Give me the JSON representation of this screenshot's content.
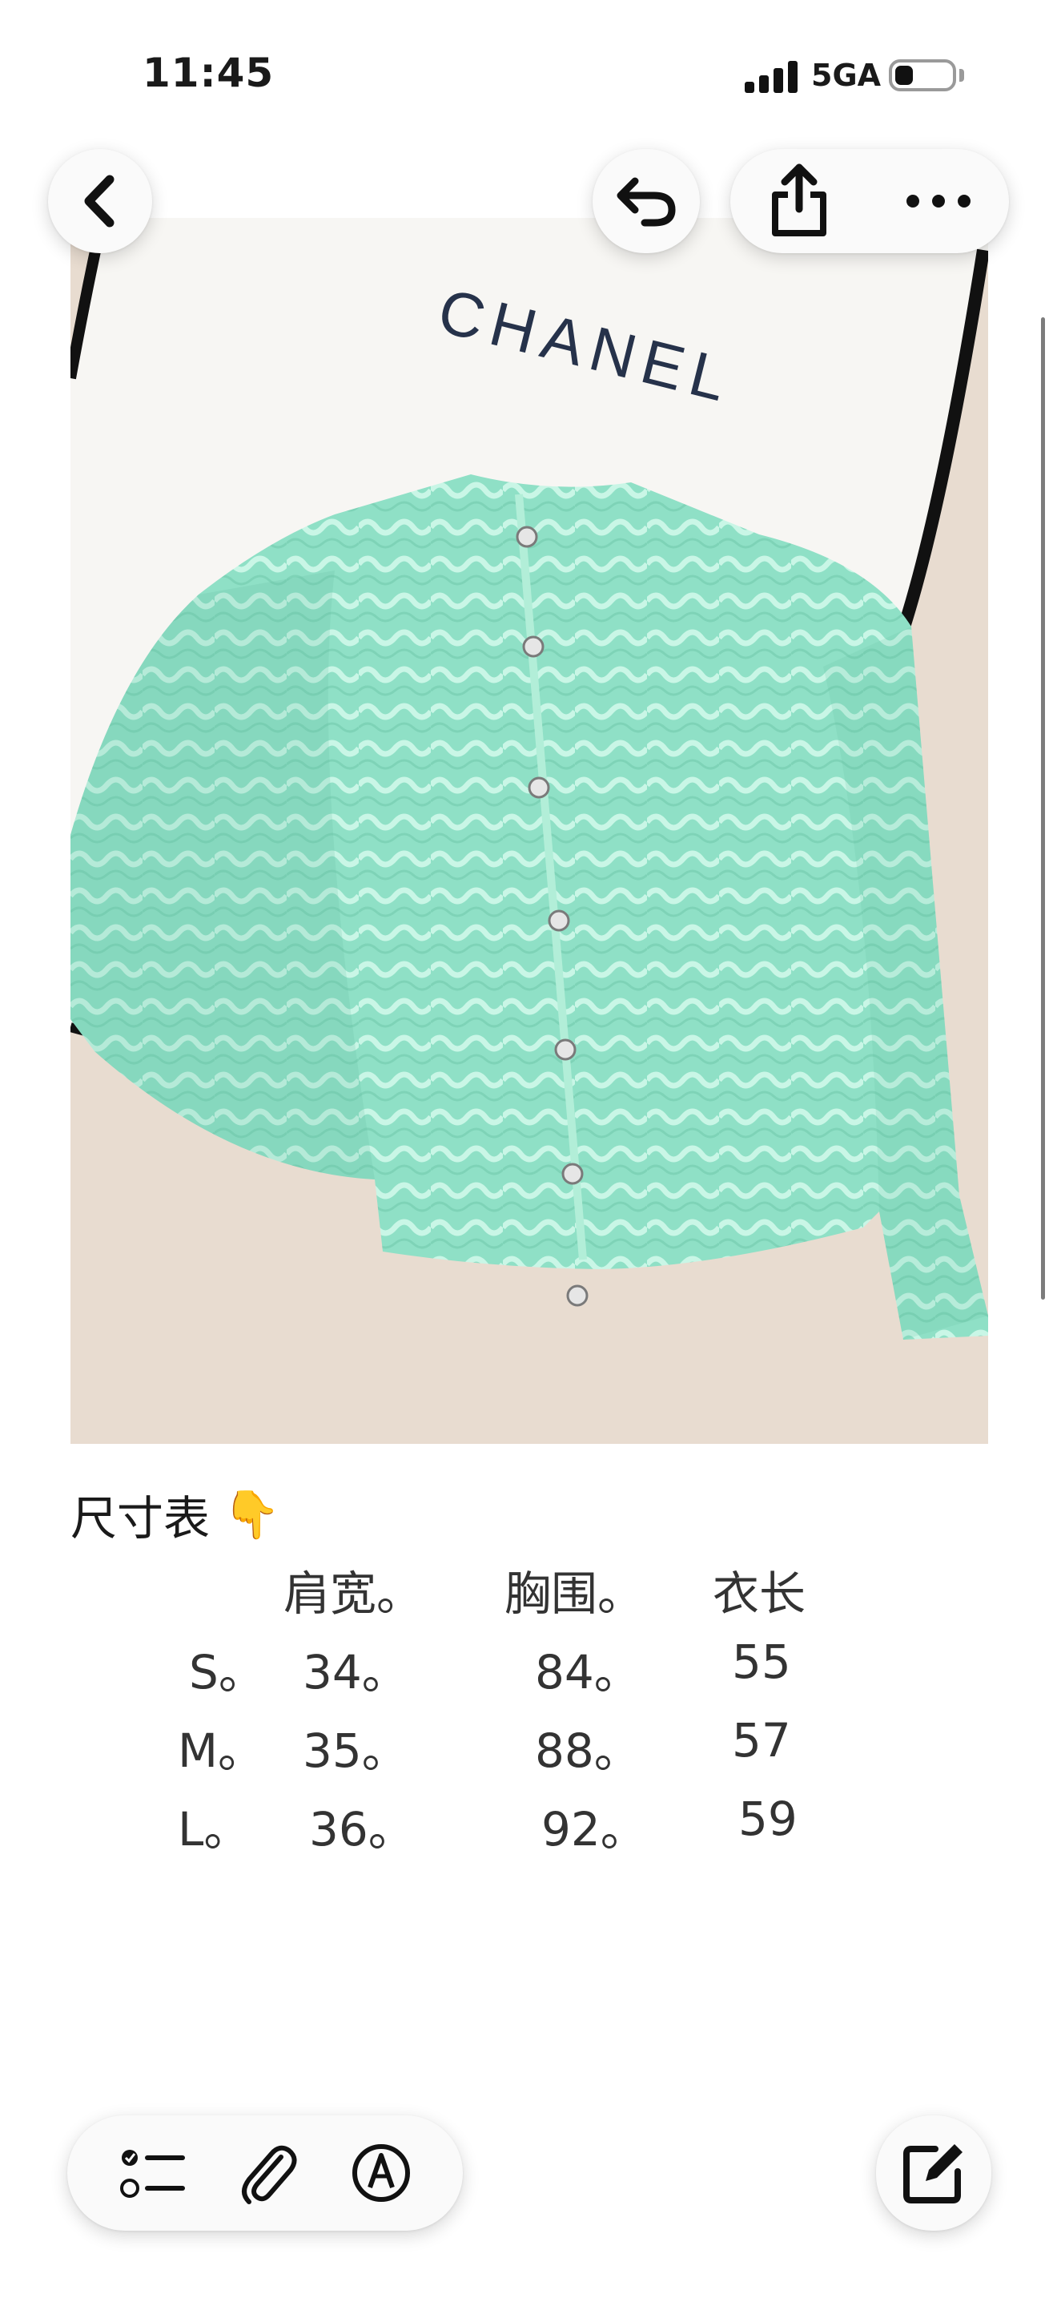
{
  "status_bar": {
    "time": "11:45",
    "network": "5GA",
    "battery_level": 0.25,
    "signal_bars": 4
  },
  "toolbar_top": {
    "back_icon": "chevron-left-icon",
    "undo_icon": "undo-icon",
    "share_icon": "share-icon",
    "more_icon": "more-icon"
  },
  "photo": {
    "brand_text": "CHANEL",
    "garment_color": "#8fe0c6",
    "background_color": "#e8dcd0"
  },
  "note": {
    "heading": "尺寸表",
    "heading_emoji": "👇",
    "size_table": {
      "headers": [
        "肩宽。",
        "胸围。",
        "衣长"
      ],
      "rows": [
        {
          "size": "S。",
          "shoulder": "34。",
          "chest": "84。",
          "length": "55"
        },
        {
          "size": "M。",
          "shoulder": "35。",
          "chest": "88。",
          "length": "57"
        },
        {
          "size": "L。",
          "shoulder": "36。",
          "chest": "92。",
          "length": "59"
        }
      ]
    }
  },
  "toolbar_bottom": {
    "checklist_icon": "checklist-icon",
    "attachment_icon": "paperclip-icon",
    "markup_icon": "markup-pen-icon",
    "compose_icon": "compose-icon"
  }
}
